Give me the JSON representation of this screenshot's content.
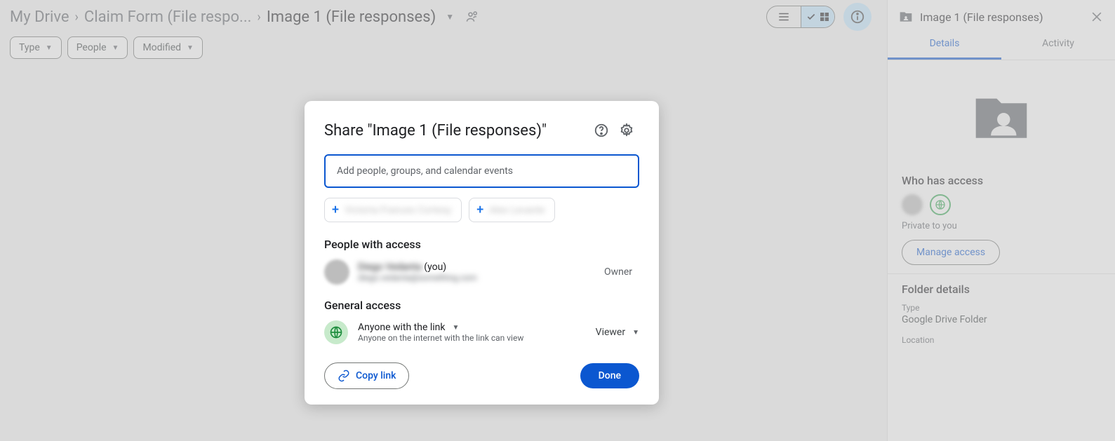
{
  "breadcrumb": {
    "root": "My Drive",
    "mid": "Claim Form (File respo...",
    "current": "Image 1 (File responses)"
  },
  "filters": {
    "type": "Type",
    "people": "People",
    "modified": "Modified"
  },
  "sidePanel": {
    "title": "Image 1 (File responses)",
    "tabs": {
      "details": "Details",
      "activity": "Activity"
    },
    "whoHasAccess": "Who has access",
    "privateText": "Private to you",
    "manageAccess": "Manage access",
    "folderDetails": "Folder details",
    "typeLabel": "Type",
    "typeValue": "Google Drive Folder",
    "locationLabel": "Location"
  },
  "dialog": {
    "title": "Share \"Image 1 (File responses)\"",
    "addPlaceholder": "Add people, groups, and calendar events",
    "sugg1": "Victoria Frances Cortesy",
    "sugg2": "Alex Levante",
    "peopleWithAccess": "People with access",
    "owner": {
      "nameBlur": "Diego Vedanta",
      "you": " (you)",
      "emailBlur": "diego.vedanta@something.com",
      "role": "Owner"
    },
    "generalAccess": "General access",
    "ga": {
      "label": "Anyone with the link",
      "sub": "Anyone on the internet with the link can view",
      "role": "Viewer"
    },
    "copyLink": "Copy link",
    "done": "Done"
  }
}
